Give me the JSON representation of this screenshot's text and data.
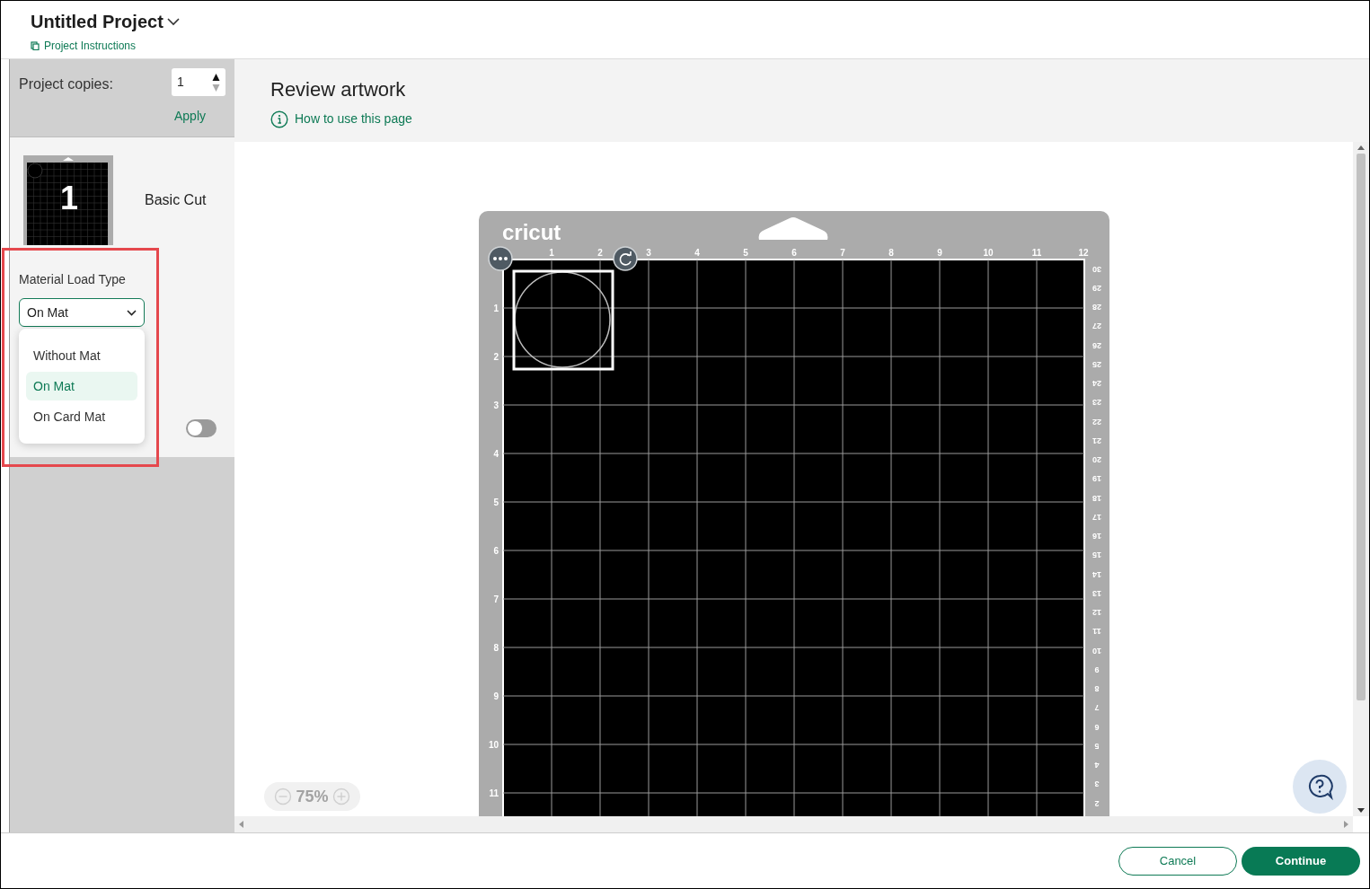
{
  "header": {
    "title": "Untitled Project",
    "instructions_link": "Project Instructions"
  },
  "copies": {
    "label": "Project copies:",
    "value": "1",
    "apply": "Apply"
  },
  "mat_card": {
    "number": "1",
    "label": "Basic Cut",
    "load_type_label": "Material Load Type",
    "load_type_value": "On Mat",
    "dropdown_open": true,
    "options": [
      {
        "label": "Without Mat",
        "selected": false
      },
      {
        "label": "On Mat",
        "selected": true
      },
      {
        "label": "On Card Mat",
        "selected": false
      }
    ],
    "toggle_on": false
  },
  "review": {
    "title": "Review artwork",
    "help_link": "How to use this page"
  },
  "mat": {
    "brand": "cricut",
    "top_ruler": [
      "1",
      "2",
      "3",
      "4",
      "5",
      "6",
      "7",
      "8",
      "9",
      "10",
      "11",
      "12"
    ],
    "left_ruler": [
      "1",
      "2",
      "3",
      "4",
      "5",
      "6",
      "7",
      "8",
      "9",
      "10",
      "11"
    ],
    "right_ruler": [
      "30",
      "29",
      "28",
      "27",
      "26",
      "25",
      "24",
      "23",
      "22",
      "21",
      "20",
      "19",
      "18",
      "17",
      "16",
      "15",
      "14",
      "13",
      "12",
      "11",
      "10",
      "9",
      "8",
      "7",
      "6",
      "5",
      "4",
      "3",
      "2"
    ]
  },
  "zoom": {
    "value": "75%"
  },
  "buttons": {
    "cancel": "Cancel",
    "continue": "Continue"
  }
}
